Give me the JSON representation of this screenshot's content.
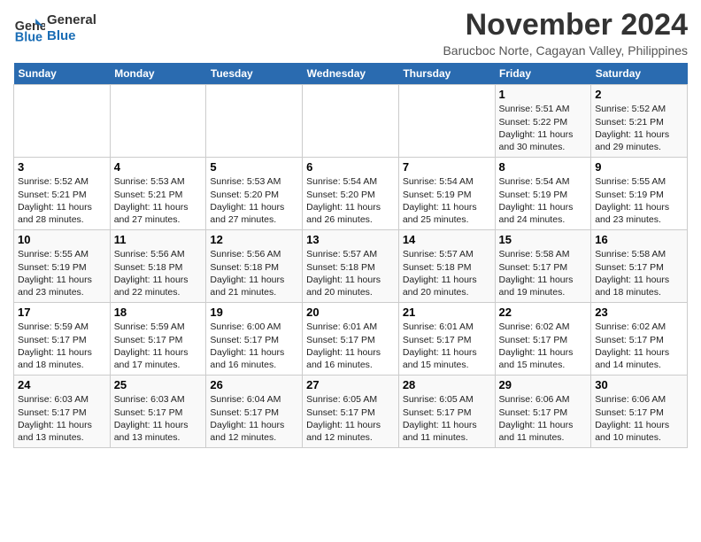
{
  "header": {
    "logo_line1": "General",
    "logo_line2": "Blue",
    "month_title": "November 2024",
    "location": "Barucboc Norte, Cagayan Valley, Philippines"
  },
  "weekdays": [
    "Sunday",
    "Monday",
    "Tuesday",
    "Wednesday",
    "Thursday",
    "Friday",
    "Saturday"
  ],
  "weeks": [
    {
      "days": [
        {
          "date": "",
          "info": ""
        },
        {
          "date": "",
          "info": ""
        },
        {
          "date": "",
          "info": ""
        },
        {
          "date": "",
          "info": ""
        },
        {
          "date": "",
          "info": ""
        },
        {
          "date": "1",
          "info": "Sunrise: 5:51 AM\nSunset: 5:22 PM\nDaylight: 11 hours and 30 minutes."
        },
        {
          "date": "2",
          "info": "Sunrise: 5:52 AM\nSunset: 5:21 PM\nDaylight: 11 hours and 29 minutes."
        }
      ]
    },
    {
      "days": [
        {
          "date": "3",
          "info": "Sunrise: 5:52 AM\nSunset: 5:21 PM\nDaylight: 11 hours and 28 minutes."
        },
        {
          "date": "4",
          "info": "Sunrise: 5:53 AM\nSunset: 5:21 PM\nDaylight: 11 hours and 27 minutes."
        },
        {
          "date": "5",
          "info": "Sunrise: 5:53 AM\nSunset: 5:20 PM\nDaylight: 11 hours and 27 minutes."
        },
        {
          "date": "6",
          "info": "Sunrise: 5:54 AM\nSunset: 5:20 PM\nDaylight: 11 hours and 26 minutes."
        },
        {
          "date": "7",
          "info": "Sunrise: 5:54 AM\nSunset: 5:19 PM\nDaylight: 11 hours and 25 minutes."
        },
        {
          "date": "8",
          "info": "Sunrise: 5:54 AM\nSunset: 5:19 PM\nDaylight: 11 hours and 24 minutes."
        },
        {
          "date": "9",
          "info": "Sunrise: 5:55 AM\nSunset: 5:19 PM\nDaylight: 11 hours and 23 minutes."
        }
      ]
    },
    {
      "days": [
        {
          "date": "10",
          "info": "Sunrise: 5:55 AM\nSunset: 5:19 PM\nDaylight: 11 hours and 23 minutes."
        },
        {
          "date": "11",
          "info": "Sunrise: 5:56 AM\nSunset: 5:18 PM\nDaylight: 11 hours and 22 minutes."
        },
        {
          "date": "12",
          "info": "Sunrise: 5:56 AM\nSunset: 5:18 PM\nDaylight: 11 hours and 21 minutes."
        },
        {
          "date": "13",
          "info": "Sunrise: 5:57 AM\nSunset: 5:18 PM\nDaylight: 11 hours and 20 minutes."
        },
        {
          "date": "14",
          "info": "Sunrise: 5:57 AM\nSunset: 5:18 PM\nDaylight: 11 hours and 20 minutes."
        },
        {
          "date": "15",
          "info": "Sunrise: 5:58 AM\nSunset: 5:17 PM\nDaylight: 11 hours and 19 minutes."
        },
        {
          "date": "16",
          "info": "Sunrise: 5:58 AM\nSunset: 5:17 PM\nDaylight: 11 hours and 18 minutes."
        }
      ]
    },
    {
      "days": [
        {
          "date": "17",
          "info": "Sunrise: 5:59 AM\nSunset: 5:17 PM\nDaylight: 11 hours and 18 minutes."
        },
        {
          "date": "18",
          "info": "Sunrise: 5:59 AM\nSunset: 5:17 PM\nDaylight: 11 hours and 17 minutes."
        },
        {
          "date": "19",
          "info": "Sunrise: 6:00 AM\nSunset: 5:17 PM\nDaylight: 11 hours and 16 minutes."
        },
        {
          "date": "20",
          "info": "Sunrise: 6:01 AM\nSunset: 5:17 PM\nDaylight: 11 hours and 16 minutes."
        },
        {
          "date": "21",
          "info": "Sunrise: 6:01 AM\nSunset: 5:17 PM\nDaylight: 11 hours and 15 minutes."
        },
        {
          "date": "22",
          "info": "Sunrise: 6:02 AM\nSunset: 5:17 PM\nDaylight: 11 hours and 15 minutes."
        },
        {
          "date": "23",
          "info": "Sunrise: 6:02 AM\nSunset: 5:17 PM\nDaylight: 11 hours and 14 minutes."
        }
      ]
    },
    {
      "days": [
        {
          "date": "24",
          "info": "Sunrise: 6:03 AM\nSunset: 5:17 PM\nDaylight: 11 hours and 13 minutes."
        },
        {
          "date": "25",
          "info": "Sunrise: 6:03 AM\nSunset: 5:17 PM\nDaylight: 11 hours and 13 minutes."
        },
        {
          "date": "26",
          "info": "Sunrise: 6:04 AM\nSunset: 5:17 PM\nDaylight: 11 hours and 12 minutes."
        },
        {
          "date": "27",
          "info": "Sunrise: 6:05 AM\nSunset: 5:17 PM\nDaylight: 11 hours and 12 minutes."
        },
        {
          "date": "28",
          "info": "Sunrise: 6:05 AM\nSunset: 5:17 PM\nDaylight: 11 hours and 11 minutes."
        },
        {
          "date": "29",
          "info": "Sunrise: 6:06 AM\nSunset: 5:17 PM\nDaylight: 11 hours and 11 minutes."
        },
        {
          "date": "30",
          "info": "Sunrise: 6:06 AM\nSunset: 5:17 PM\nDaylight: 11 hours and 10 minutes."
        }
      ]
    }
  ]
}
